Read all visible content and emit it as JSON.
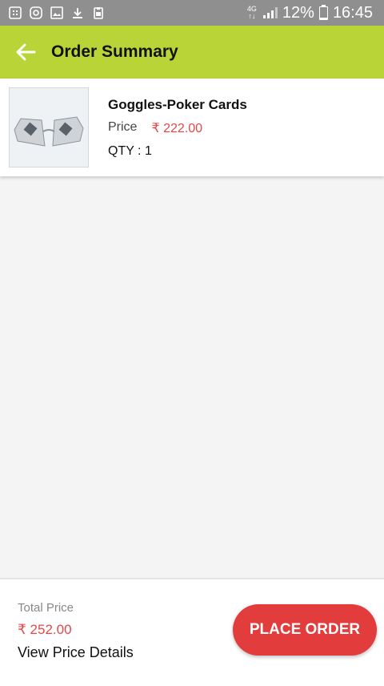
{
  "status_bar": {
    "icons": [
      "sd-card-icon",
      "instagram-icon",
      "image-icon",
      "download-icon",
      "clipboard-icon"
    ],
    "network": "4G",
    "battery_percent_label": "12%",
    "battery_level": 0.12,
    "time": "16:45"
  },
  "header": {
    "title": "Order Summary",
    "back_icon": "arrow-left-icon",
    "background_color": "#b9d437"
  },
  "order": {
    "product_name": "Goggles-Poker Cards",
    "price_label": "Price",
    "price_value": "₹ 222.00",
    "qty_text": "QTY : 1"
  },
  "footer": {
    "total_label": "Total Price",
    "total_value": "₹ 252.00",
    "view_details": "View Price Details",
    "place_order": "PLACE ORDER",
    "accent_color": "#e23c3c"
  }
}
